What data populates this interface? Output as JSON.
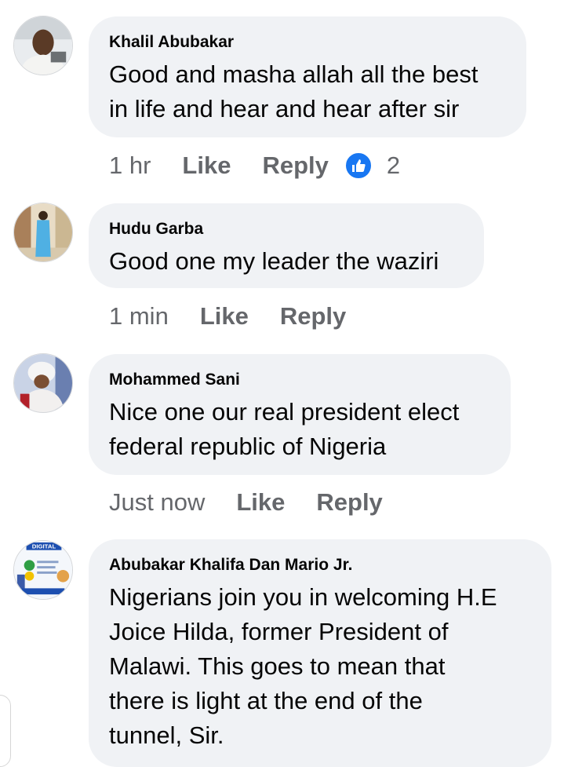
{
  "comments": [
    {
      "author": "Khalil Abubakar",
      "text": "Good and masha allah all the best\nin life and hear and hear after sir",
      "time": "1 hr",
      "like_label": "Like",
      "reply_label": "Reply",
      "reaction_count": "2",
      "reaction_icon": "thumbs-up-icon"
    },
    {
      "author": "Hudu Garba",
      "text": "Good one my leader the waziri",
      "time": "1 min",
      "like_label": "Like",
      "reply_label": "Reply"
    },
    {
      "author": "Mohammed Sani",
      "text": "Nice one our real president elect\nfederal republic of Nigeria",
      "time": "Just now",
      "like_label": "Like",
      "reply_label": "Reply"
    },
    {
      "author": "Abubakar Khalifa Dan Mario Jr.",
      "text": "Nigerians join you in welcoming H.E\nJoice Hilda, former President of\nMalawi. This goes to mean that\nthere is light at the end of the\ntunnel, Sir.",
      "avatar_text": "DIGITAL"
    }
  ],
  "colors": {
    "bubble": "#f0f2f5",
    "meta_text": "#65676b",
    "like_blue": "#1877f2"
  }
}
